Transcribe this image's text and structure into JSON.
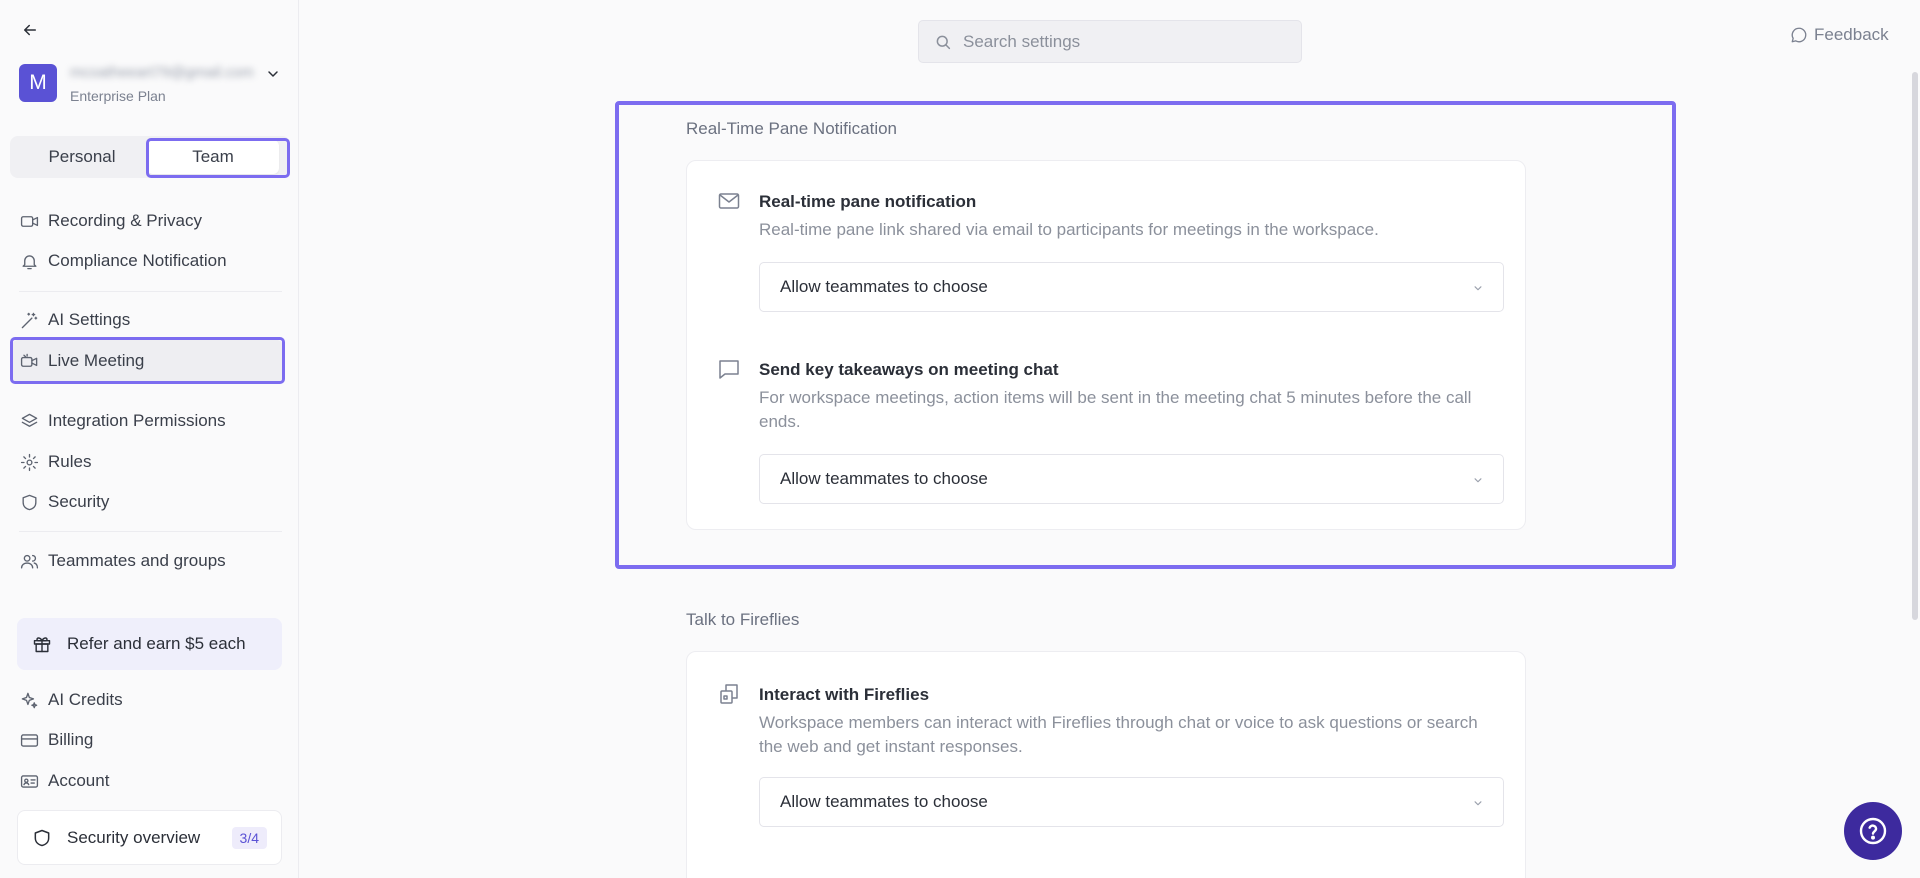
{
  "sidebar": {
    "user": {
      "avatar_letter": "M",
      "email": "mcoatheeart79@gmail.com",
      "plan": "Enterprise Plan"
    },
    "segment": {
      "personal": "Personal",
      "team": "Team",
      "active": "Team"
    },
    "items": [
      {
        "label": "Recording & Privacy",
        "icon": "video-icon"
      },
      {
        "label": "Compliance Notification",
        "icon": "bell-icon"
      },
      {
        "label": "AI Settings",
        "icon": "magic-wand-icon"
      },
      {
        "label": "Live Meeting",
        "icon": "live-video-icon"
      },
      {
        "label": "Integration Permissions",
        "icon": "layers-icon"
      },
      {
        "label": "Rules",
        "icon": "gear-icon"
      },
      {
        "label": "Security",
        "icon": "shield-icon"
      },
      {
        "label": "Teammates and groups",
        "icon": "users-icon"
      },
      {
        "label": "AI Credits",
        "icon": "sparkle-icon"
      },
      {
        "label": "Billing",
        "icon": "credit-card-icon"
      },
      {
        "label": "Account",
        "icon": "id-card-icon"
      }
    ],
    "refer": "Refer and earn $5 each",
    "security_overview": {
      "label": "Security overview",
      "badge": "3/4"
    }
  },
  "search": {
    "placeholder": "Search settings"
  },
  "feedback": "Feedback",
  "sections": [
    {
      "title": "Real-Time Pane Notification",
      "settings": [
        {
          "title": "Real-time pane notification",
          "description": "Real-time pane link shared via email to participants for meetings in the workspace.",
          "value": "Allow teammates to choose"
        },
        {
          "title": "Send key takeaways on meeting chat",
          "description": "For workspace meetings, action items will be sent in the meeting chat 5 minutes before the call ends.",
          "value": "Allow teammates to choose"
        }
      ]
    },
    {
      "title": "Talk to Fireflies",
      "settings": [
        {
          "title": "Interact with Fireflies",
          "description": "Workspace members can interact with Fireflies through chat or voice to ask questions or search the web and get instant responses.",
          "value": "Allow teammates to choose"
        }
      ]
    }
  ],
  "colors": {
    "accent": "#5a52d5",
    "highlight": "#7c6cf0",
    "help": "#3d2a9e"
  }
}
